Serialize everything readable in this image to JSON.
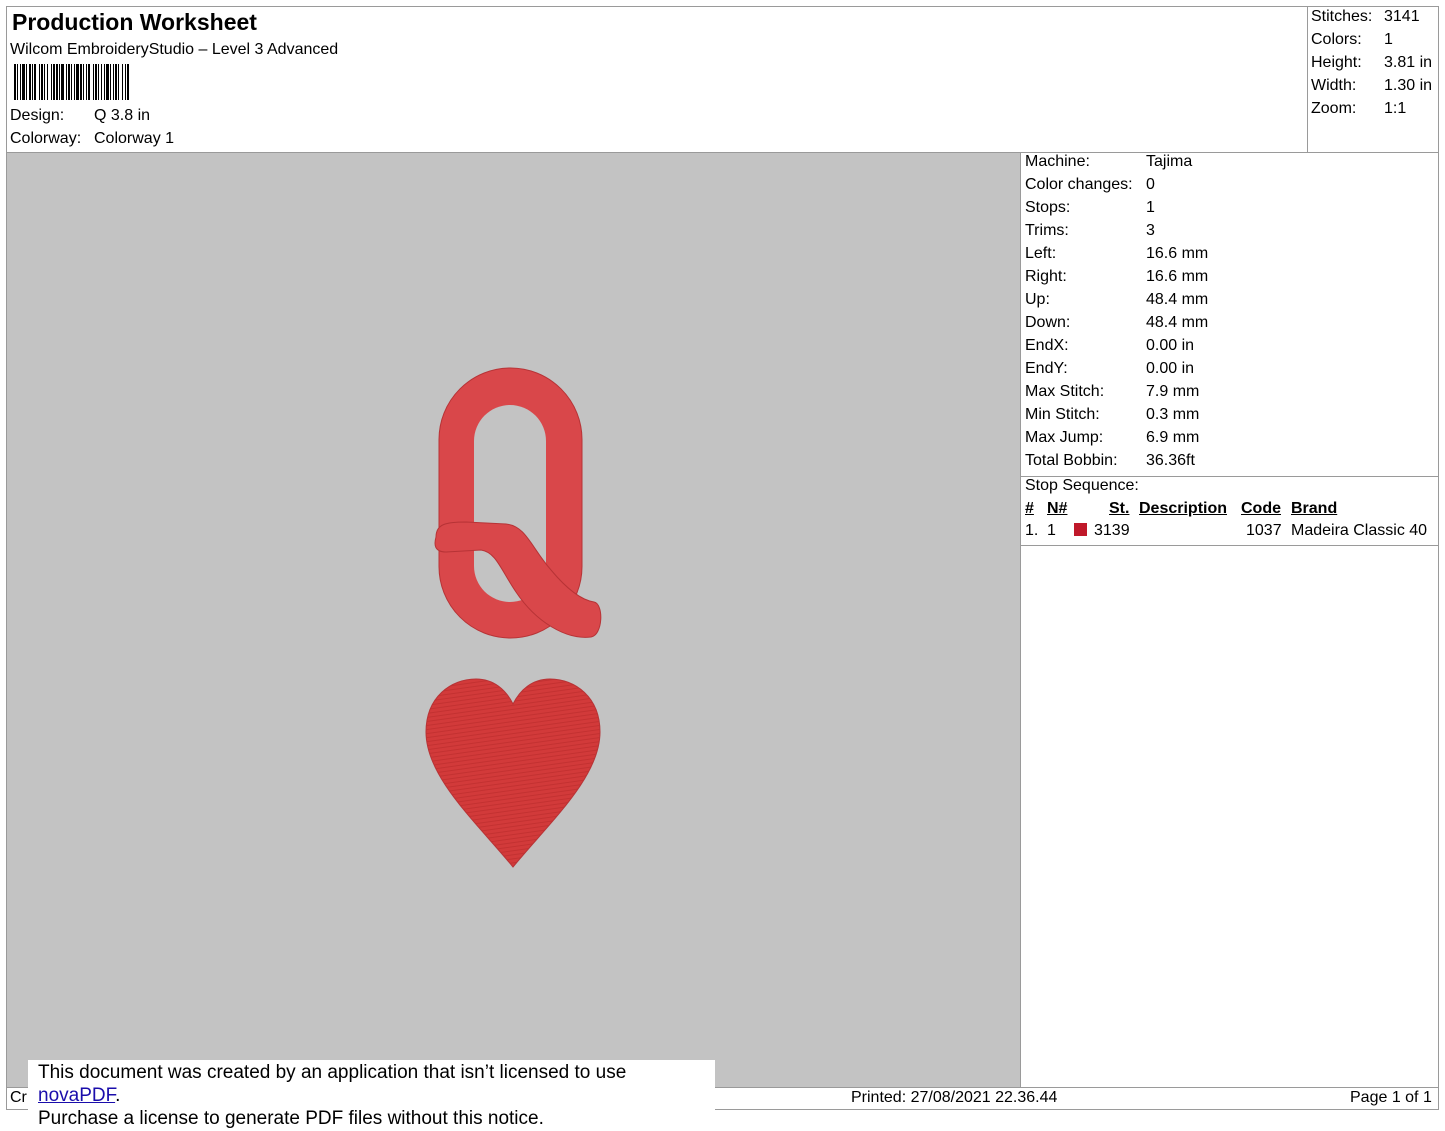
{
  "header": {
    "title": "Production Worksheet",
    "software": "Wilcom EmbroideryStudio – Level 3 Advanced",
    "design_label": "Design:",
    "design_value": "Q 3.8 in",
    "colorway_label": "Colorway:",
    "colorway_value": "Colorway 1"
  },
  "summary": [
    {
      "label": "Stitches:",
      "value": "3141"
    },
    {
      "label": "Colors:",
      "value": "1"
    },
    {
      "label": "Height:",
      "value": "3.81 in"
    },
    {
      "label": "Width:",
      "value": "1.30 in"
    },
    {
      "label": "Zoom:",
      "value": "1:1"
    }
  ],
  "machine_stats": [
    {
      "label": "Machine:",
      "value": "Tajima"
    },
    {
      "label": "Color changes:",
      "value": "0"
    },
    {
      "label": "Stops:",
      "value": "1"
    },
    {
      "label": "Trims:",
      "value": "3"
    },
    {
      "label": "Left:",
      "value": "16.6 mm"
    },
    {
      "label": "Right:",
      "value": "16.6 mm"
    },
    {
      "label": "Up:",
      "value": "48.4 mm"
    },
    {
      "label": "Down:",
      "value": "48.4 mm"
    },
    {
      "label": "EndX:",
      "value": "0.00 in"
    },
    {
      "label": "EndY:",
      "value": "0.00 in"
    },
    {
      "label": "Max Stitch:",
      "value": "7.9 mm"
    },
    {
      "label": "Min Stitch:",
      "value": "0.3 mm"
    },
    {
      "label": "Max Jump:",
      "value": "6.9 mm"
    },
    {
      "label": "Total Bobbin:",
      "value": "36.36ft"
    }
  ],
  "stop_sequence": {
    "title": "Stop Sequence:",
    "columns": {
      "num": "#",
      "n": "N#",
      "st": "St.",
      "description": "Description",
      "code": "Code",
      "brand": "Brand"
    },
    "rows": [
      {
        "num": "1.",
        "n": "1",
        "color": "#c0182a",
        "st": "3139",
        "description": "",
        "code": "1037",
        "brand": "Madeira Classic 40"
      }
    ]
  },
  "design_preview": {
    "background": "#c3c3c3",
    "thread_color": "#d23a3a"
  },
  "footer": {
    "left_fragment": "Cr",
    "printed": "Printed: 27/08/2021 22.36.44",
    "page": "Page 1 of 1"
  },
  "notice": {
    "line1_prefix": "This document was created by an application that isn’t licensed to use ",
    "link": "novaPDF",
    "line1_suffix": ".",
    "line2": "Purchase a license to generate PDF files without this notice."
  }
}
